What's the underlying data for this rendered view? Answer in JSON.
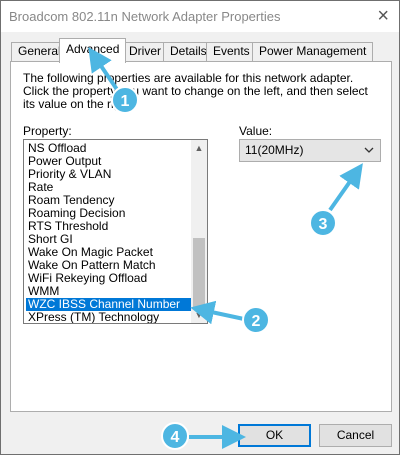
{
  "window": {
    "title": "Broadcom 802.11n Network Adapter Properties",
    "close_glyph": "×"
  },
  "tabs": [
    {
      "label": "General"
    },
    {
      "label": "Advanced",
      "active": true
    },
    {
      "label": "Driver"
    },
    {
      "label": "Details"
    },
    {
      "label": "Events"
    },
    {
      "label": "Power Management"
    }
  ],
  "panel": {
    "description": "The following properties are available for this network adapter. Click the property you want to change on the left, and then select its value on the right.",
    "property_label": "Property:",
    "value_label": "Value:"
  },
  "property_list": {
    "items": [
      "NS Offload",
      "Power Output",
      "Priority & VLAN",
      "Rate",
      "Roam Tendency",
      "Roaming Decision",
      "RTS Threshold",
      "Short GI",
      "Wake On Magic Packet",
      "Wake On Pattern Match",
      "WiFi Rekeying Offload",
      "WMM",
      "WZC IBSS Channel Number",
      "XPress (TM) Technology"
    ],
    "selected": "WZC IBSS Channel Number"
  },
  "value_dropdown": {
    "value": "11(20MHz)"
  },
  "buttons": {
    "ok": "OK",
    "cancel": "Cancel"
  },
  "callouts": {
    "items": [
      "1",
      "2",
      "3",
      "4"
    ],
    "color": "#4db6e2"
  },
  "colors": {
    "selection": "#0078d7",
    "window_bg": "#f0f0f0"
  }
}
